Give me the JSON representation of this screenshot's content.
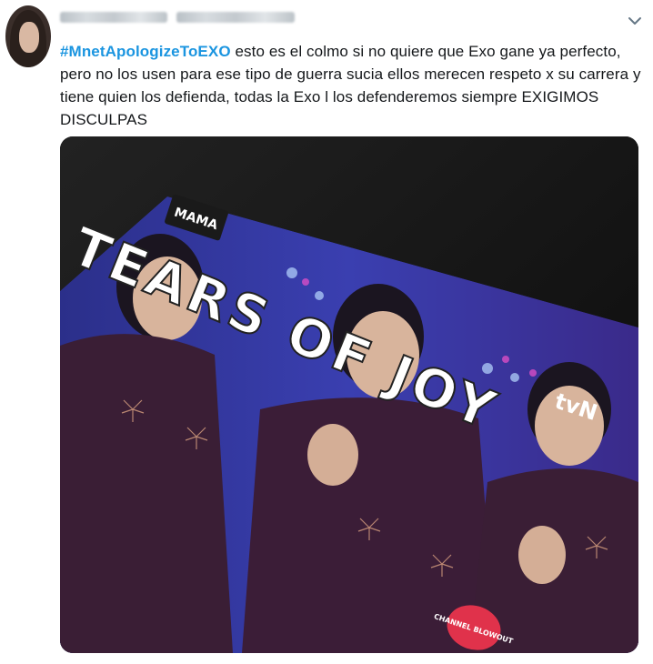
{
  "tweet": {
    "hashtag": "#MnetApologizeToEXO",
    "body_text": " esto es el colmo si no quiere que Exo gane ya perfecto, pero no los usen para ese tipo de guerra sucia ellos merecen respeto x su carrera y tiene quien los defienda, todas la Exo l los defenderemos siempre EXIGIMOS DISCULPAS",
    "icons": {
      "menu": "chevron-down-icon"
    },
    "media": {
      "overlay_caption": "TEARS OF JOY",
      "broadcaster_logo": "tvN",
      "event_logo": "MAMA",
      "corner_badge": "CHANNEL BLOWOUT"
    }
  },
  "colors": {
    "hashtag": "#1b95e0",
    "text": "#14171a",
    "icon": "#657786"
  }
}
